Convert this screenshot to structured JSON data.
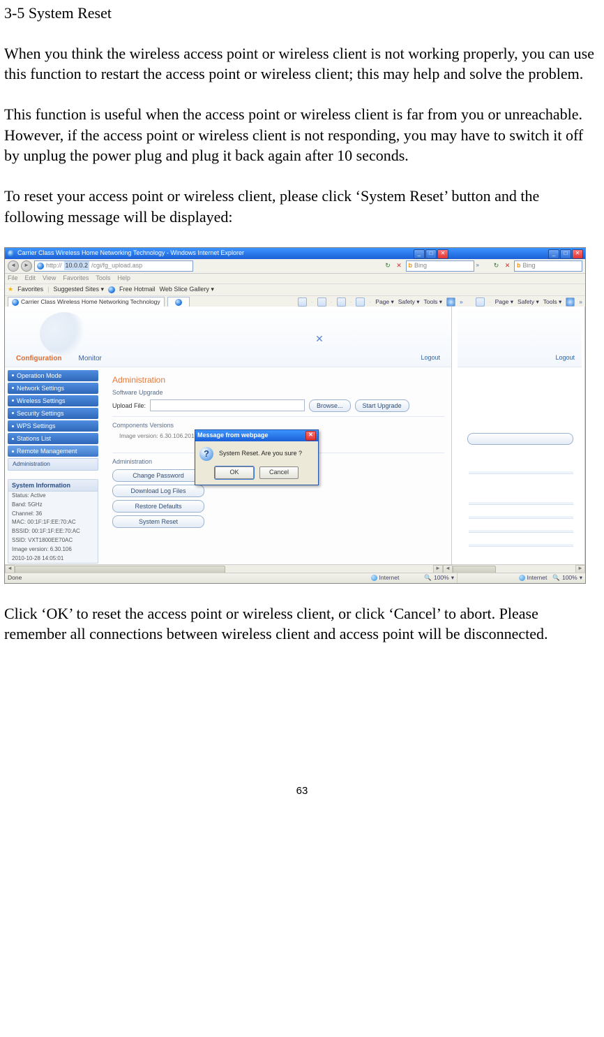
{
  "doc": {
    "heading": "3-5 System Reset",
    "p1": "When you think the wireless access point or wireless client is not working properly, you can use this function to restart the access point or wireless client; this may help and solve the problem.",
    "p2": "This function is useful when the access point or wireless client is far from you or unreachable. However, if the access point or wireless client is not responding, you may have to switch it off by unplug the power plug and plug it back again after 10 seconds.",
    "p3": "To reset your access point or wireless client, please click ‘System Reset’ button and the following message will be displayed:",
    "p4": "Click ‘OK’ to reset the access point or wireless client, or click ‘Cancel’ to abort. Please remember all connections between wireless client and access point will be disconnected.",
    "page_number": "63"
  },
  "browser": {
    "title": "Carrier Class Wireless Home Networking Technology - Windows Internet Explorer",
    "url_ip": "10.0.0.2",
    "url_suffix": "/cgi/fg_upload.asp",
    "search_placeholder": "Bing",
    "menus": [
      "File",
      "Edit",
      "View",
      "Favorites",
      "Tools",
      "Help"
    ],
    "fav_label": "Favorites",
    "fav_items": [
      "Suggested Sites ▾",
      "Free Hotmail",
      "Web Slice Gallery ▾"
    ],
    "tab_label": "Carrier Class Wireless Home Networking Technology",
    "cmd_items": [
      "Page ▾",
      "Safety ▾",
      "Tools ▾"
    ],
    "status_done": "Done",
    "status_zone": "Internet",
    "status_zoom": "100%"
  },
  "app": {
    "tab_active": "Configuration",
    "tab_other": "Monitor",
    "logout": "Logout",
    "nav": [
      "Operation Mode",
      "Network Settings",
      "Wireless Settings",
      "Security Settings",
      "WPS Settings",
      "Stations List",
      "Remote Management"
    ],
    "nav_sub": "Administration",
    "sysinfo": {
      "title": "System Information",
      "rows": [
        "Status: Active",
        "Band: 5GHz",
        "Channel: 36",
        "MAC: 00:1F:1F:EE:70:AC",
        "BSSID: 00:1F:1F:EE:70:AC",
        "SSID: VXT1800EE70AC",
        "Image version: 6.30.106",
        "2010-10-28 14:05:01"
      ]
    },
    "main": {
      "admin_title": "Administration",
      "sw_upgrade": "Software Upgrade",
      "upload_label": "Upload File:",
      "browse": "Browse...",
      "start_upgrade": "Start Upgrade",
      "comp_ver": "Components Versions",
      "img_ver": "Image version: 6.30.106.201",
      "btns": [
        "Change Password",
        "Download Log Files",
        "Restore Defaults",
        "System Reset"
      ]
    }
  },
  "dialog": {
    "title": "Message from webpage",
    "msg": "System Reset. Are you sure ?",
    "ok": "OK",
    "cancel": "Cancel"
  }
}
